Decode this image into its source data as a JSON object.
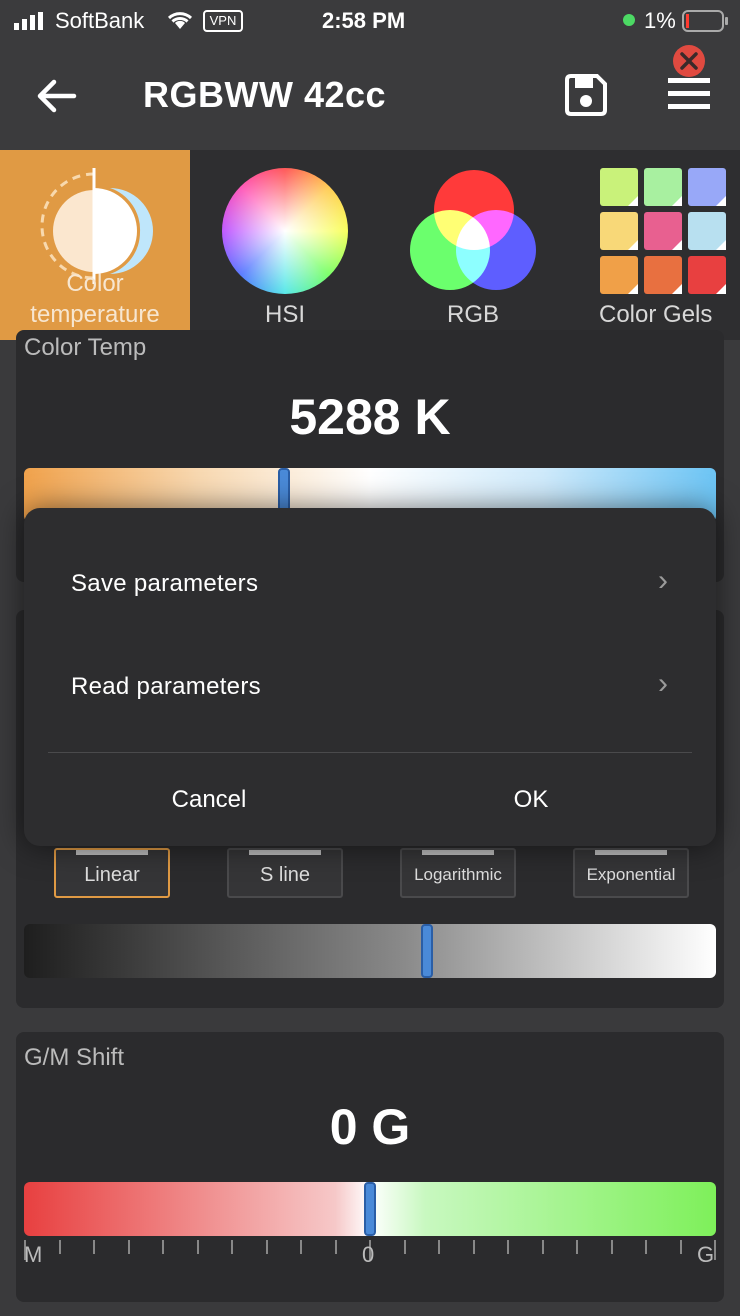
{
  "status_bar": {
    "carrier": "SoftBank",
    "vpn": "VPN",
    "time": "2:58 PM",
    "battery": "1%"
  },
  "nav": {
    "title": "RGBWW 42cc",
    "back_icon": "back-arrow-icon",
    "save_icon": "floppy-disk-icon",
    "menu_icon": "hamburger-menu-icon",
    "notification_icon": "close-badge-icon"
  },
  "tabs": [
    {
      "label_line1": "Color",
      "label_line2": "temperature",
      "active": true
    },
    {
      "label": "HSI"
    },
    {
      "label": "RGB"
    },
    {
      "label": "Color Gels"
    }
  ],
  "color_gels_swatches": [
    "#c9f27a",
    "#a8f0a0",
    "#98a8f8",
    "#f8d878",
    "#e86090",
    "#b8e0f0",
    "#f0a048",
    "#e87040",
    "#e84040"
  ],
  "color_temp": {
    "label": "Color Temp",
    "value": "5288 K",
    "slider_fraction": 0.375
  },
  "dimming": {
    "curves": [
      "Linear",
      "S line",
      "Logarithmic",
      "Exponential"
    ],
    "selected": "Linear",
    "slider_fraction": 0.583
  },
  "gm_shift": {
    "label": "G/M Shift",
    "value": "0 G",
    "slider_fraction": 0.5,
    "scale_left": "M",
    "scale_center": "0",
    "scale_right": "G"
  },
  "dialog": {
    "items": [
      {
        "label": "Save parameters"
      },
      {
        "label": "Read parameters"
      }
    ],
    "cancel": "Cancel",
    "ok": "OK"
  },
  "colors": {
    "accent_orange": "#e09a44",
    "slider_thumb": "#4a8ad8"
  }
}
